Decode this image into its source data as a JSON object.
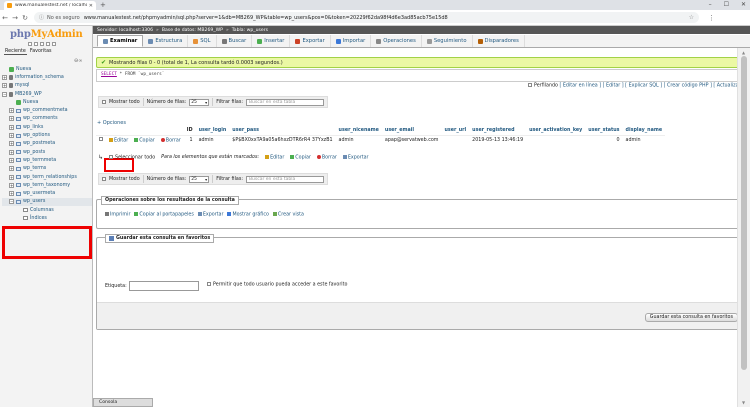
{
  "browser": {
    "tab_title": "www.manualestest.net / localho",
    "url_security": "No es seguro",
    "url": "www.manualestest.net/phpmyadmin/sql.php?server=1&db=MB269_WP&table=wp_users&pos=0&token=20229f62da98f4d6e3ad85acb75e15d8"
  },
  "logo": {
    "php": "php",
    "my": "MyAdmin"
  },
  "nav": {
    "tabs": [
      "Reciente",
      "Favoritas"
    ],
    "tree": [
      {
        "label": "Nueva",
        "level": 1,
        "kind": "plus"
      },
      {
        "label": "information_schema",
        "level": 1,
        "kind": "db"
      },
      {
        "label": "mysql",
        "level": 1,
        "kind": "db"
      },
      {
        "label": "MB269_WP",
        "level": 1,
        "kind": "db"
      },
      {
        "label": "Nueva",
        "level": 2,
        "kind": "plus"
      },
      {
        "label": "wp_commentmeta",
        "level": 2,
        "kind": "tbl"
      },
      {
        "label": "wp_comments",
        "level": 2,
        "kind": "tbl"
      },
      {
        "label": "wp_links",
        "level": 2,
        "kind": "tbl"
      },
      {
        "label": "wp_options",
        "level": 2,
        "kind": "tbl"
      },
      {
        "label": "wp_postmeta",
        "level": 2,
        "kind": "tbl"
      },
      {
        "label": "wp_posts",
        "level": 2,
        "kind": "tbl"
      },
      {
        "label": "wp_termmeta",
        "level": 2,
        "kind": "tbl"
      },
      {
        "label": "wp_terms",
        "level": 2,
        "kind": "tbl"
      },
      {
        "label": "wp_term_relationships",
        "level": 2,
        "kind": "tbl"
      },
      {
        "label": "wp_term_taxonomy",
        "level": 2,
        "kind": "tbl"
      },
      {
        "label": "wp_usermeta",
        "level": 2,
        "kind": "tbl"
      },
      {
        "label": "wp_users",
        "level": 2,
        "kind": "tbl"
      },
      {
        "label": "Columnas",
        "level": 3,
        "kind": "col"
      },
      {
        "label": "Índices",
        "level": 3,
        "kind": "col"
      }
    ]
  },
  "breadcrumb": [
    "Servidor: localhost:3306",
    "Base de datos: MB269_WP",
    "Tabla: wp_users"
  ],
  "tabs": [
    "Examinar",
    "Estructura",
    "SQL",
    "Buscar",
    "Insertar",
    "Exportar",
    "Importar",
    "Operaciones",
    "Seguimiento",
    "Disparadores"
  ],
  "tab_icon_colors": [
    "#6b8cb3",
    "#6b8cb3",
    "#e69138",
    "#777777",
    "#4caf50",
    "#cc4125",
    "#3c78d8",
    "#888888",
    "#999999",
    "#b45f06"
  ],
  "success_msg": "Mostrando filas 0 - 0 (total de 1, La consulta tardó 0.0003 segundos.)",
  "sql": {
    "keyword": "SELECT",
    "rest": "* FROM `wp_users`"
  },
  "sql_links": {
    "profiling": "Perfilando",
    "rest": "[ Editar en línea ] [ Editar ] [ Explicar SQL ] [ Crear código PHP ] [ Actualizar ]"
  },
  "navrow": {
    "show_all": "Mostrar todo",
    "rows_label": "Número de filas:",
    "rows_value": "25",
    "filter_label": "Filtrar filas:",
    "filter_placeholder": "Buscar en esta tabla"
  },
  "options_label": "+ Opciones",
  "table": {
    "headers": [
      "ID",
      "user_login",
      "user_pass",
      "user_nicename",
      "user_email",
      "user_url",
      "user_registered",
      "user_activation_key",
      "user_status",
      "display_name"
    ],
    "actions": [
      "Editar",
      "Copiar",
      "Borrar"
    ],
    "row": [
      "1",
      "admin",
      "$P$BX0xxTA9a05a6hxzDTR6rR4 37YxzB1",
      "admin",
      "apap@servatweb.com",
      "",
      "2019-05-13 13:46:19",
      "",
      "0",
      "admin"
    ]
  },
  "bulk": {
    "select_all": "Seleccionar todo",
    "with_marked": "Para los elementos que están marcados:",
    "actions": [
      "Editar",
      "Copiar",
      "Borrar",
      "Exportar"
    ]
  },
  "ops": {
    "title": "Operaciones sobre los resultados de la consulta",
    "links": [
      "Imprimir",
      "Copiar al portapapeles",
      "Exportar",
      "Mostrar gráfico",
      "Crear vista"
    ]
  },
  "bookmark": {
    "title": "Guardar esta consulta en favoritos",
    "label": "Etiqueta:",
    "share": "Permitir que todo usuario pueda acceder a este favorito",
    "button": "Guardar esta consulta en favoritos"
  },
  "console": "Consola"
}
